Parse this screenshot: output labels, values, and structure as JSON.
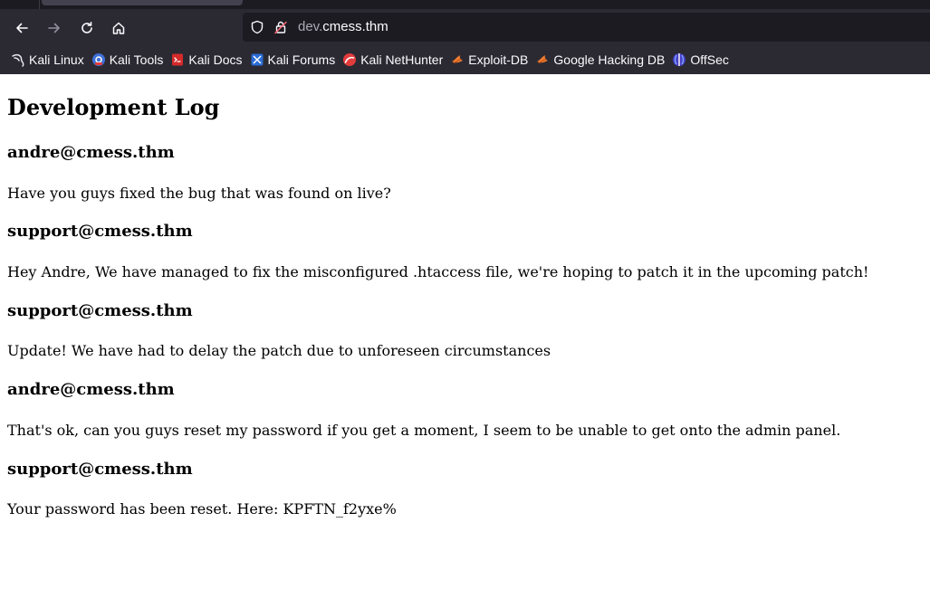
{
  "browser": {
    "url_host_prefix": "dev.",
    "url_host_domain": "cmess.thm"
  },
  "bookmarks": [
    {
      "label": "Kali Linux",
      "icon": "kali-dragon-icon"
    },
    {
      "label": "Kali Tools",
      "icon": "kali-tools-icon"
    },
    {
      "label": "Kali Docs",
      "icon": "kali-docs-icon"
    },
    {
      "label": "Kali Forums",
      "icon": "kali-forums-icon"
    },
    {
      "label": "Kali NetHunter",
      "icon": "kali-nethunter-icon"
    },
    {
      "label": "Exploit-DB",
      "icon": "exploit-db-icon"
    },
    {
      "label": "Google Hacking DB",
      "icon": "ghdb-icon"
    },
    {
      "label": "OffSec",
      "icon": "offsec-icon"
    }
  ],
  "page": {
    "title": "Development Log",
    "entries": [
      {
        "author": "andre@cmess.thm",
        "message": "Have you guys fixed the bug that was found on live?"
      },
      {
        "author": "support@cmess.thm",
        "message": "Hey Andre, We have managed to fix the misconfigured .htaccess file, we're hoping to patch it in the upcoming patch!"
      },
      {
        "author": "support@cmess.thm",
        "message": "Update! We have had to delay the patch due to unforeseen circumstances"
      },
      {
        "author": "andre@cmess.thm",
        "message": "That's ok, can you guys reset my password if you get a moment, I seem to be unable to get onto the admin panel."
      },
      {
        "author": "support@cmess.thm",
        "message": "Your password has been reset. Here: KPFTN_f2yxe%"
      }
    ]
  }
}
